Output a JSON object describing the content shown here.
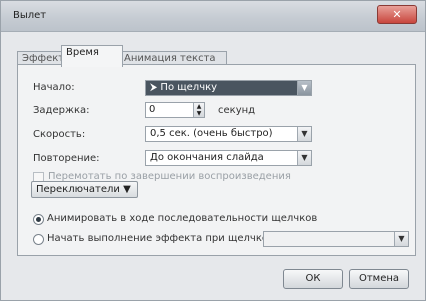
{
  "window": {
    "title": "Вылет",
    "close_glyph": "✕"
  },
  "tabs": [
    {
      "label": "Эффект"
    },
    {
      "label": "Время"
    },
    {
      "label": "Анимация текста"
    }
  ],
  "timing": {
    "start_label": "Начало:",
    "start_value": "По щелчку",
    "start_icon": "mouse-pointer-icon",
    "delay_label": "Задержка:",
    "delay_value": "0",
    "delay_unit": "секунд",
    "speed_label": "Скорость:",
    "speed_value": "0,5 сек. (очень быстро)",
    "repeat_label": "Повторение:",
    "repeat_value": "До окончания слайда",
    "rewind_label": "Перемотать по завершении воспроизведения",
    "triggers_label": "Переключатели"
  },
  "trigger_options": {
    "animate_sequence_label": "Анимировать в ходе последовательности щелчков",
    "start_on_click_label": "Начать выполнение эффекта при щелчке",
    "start_on_click_value": ""
  },
  "buttons": {
    "ok_label": "ОК",
    "cancel_label": "Отмена"
  },
  "colors": {
    "selected_combo": "#4a5560",
    "titlebar": "#c6ccd3",
    "close": "#c8463d"
  }
}
